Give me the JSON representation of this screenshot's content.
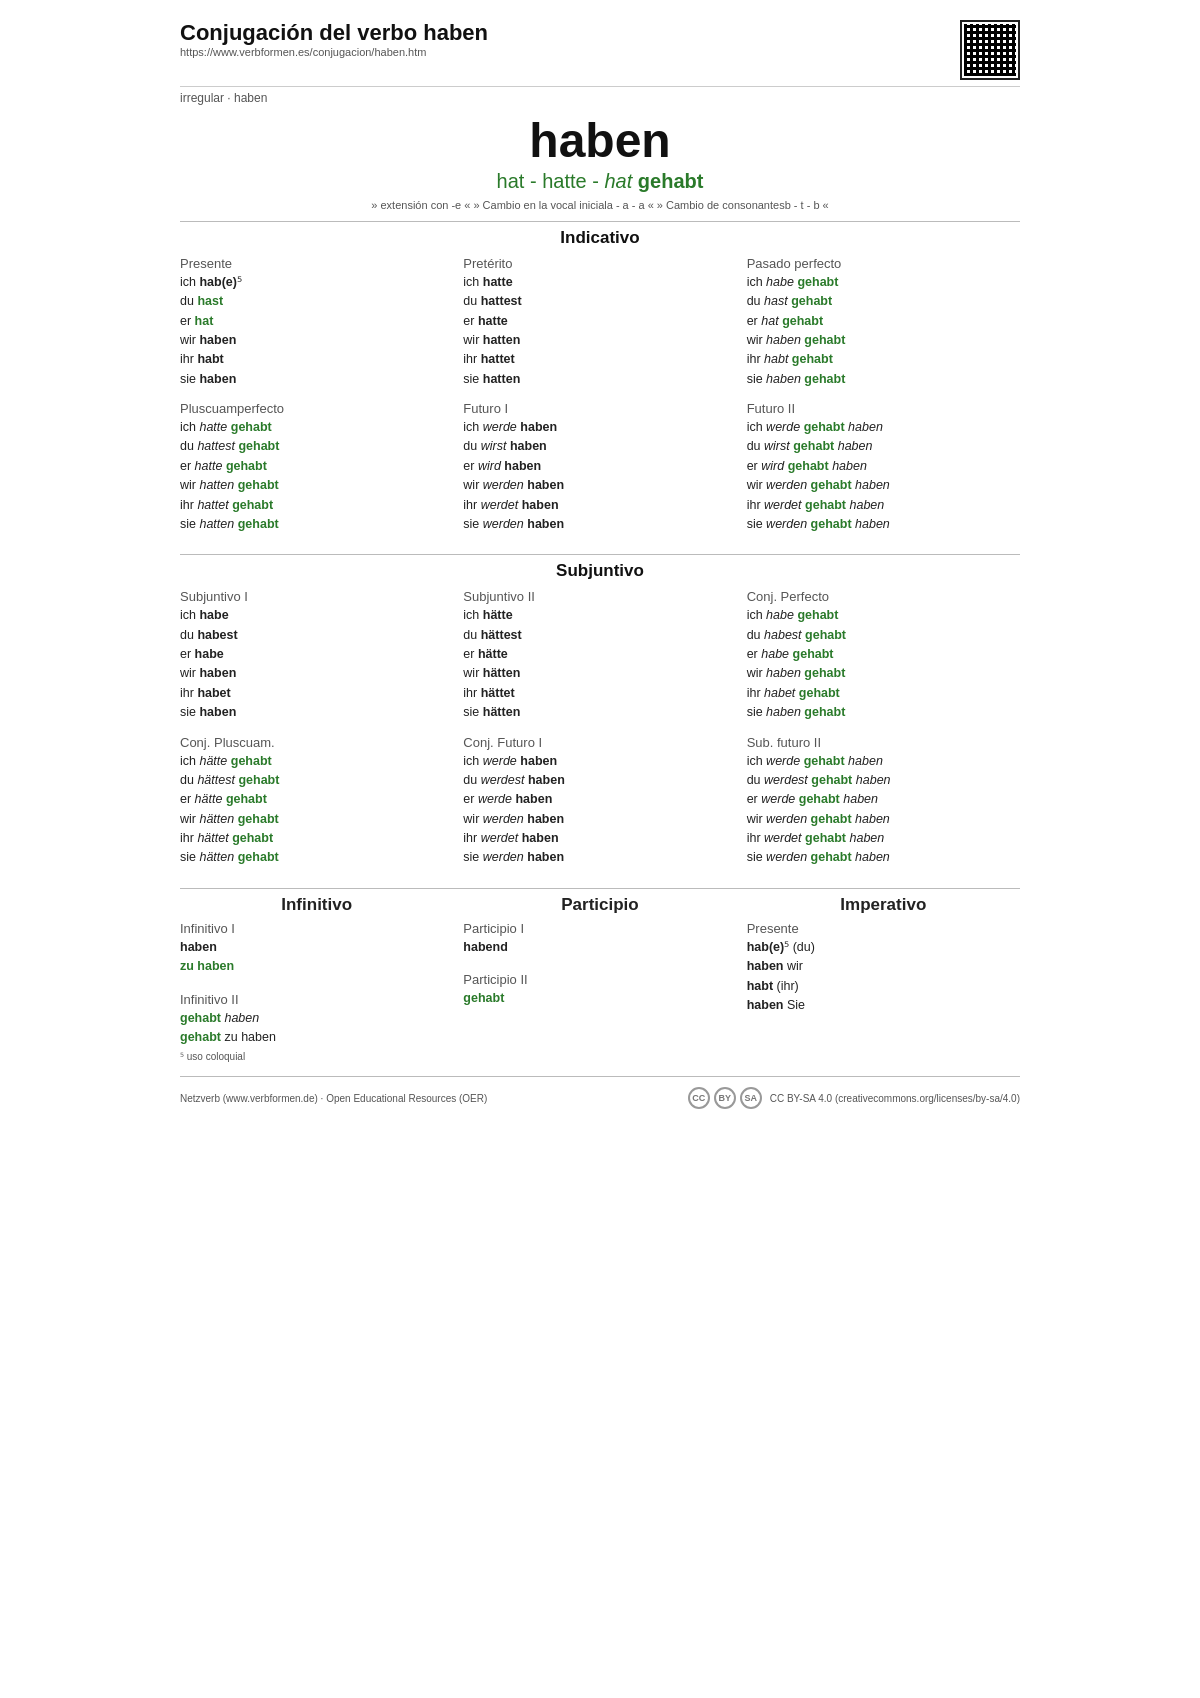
{
  "header": {
    "title": "Conjugación del verbo haben",
    "url": "https://www.verbformen.es/conjugacion/haben.htm",
    "tag": "irregular · haben"
  },
  "verb": {
    "main": "haben",
    "forms_line": "hat - hatte - hat gehabt",
    "extensions": "» extensión con -e « » Cambio en la vocal iniciala - a - a « » Cambio de consonantesb - t - b «"
  },
  "sections": {
    "indicativo": {
      "label": "Indicativo",
      "presente": {
        "title": "Presente",
        "rows": [
          "ich hab(e)⁵",
          "du hast",
          "er hat",
          "wir haben",
          "ihr habt",
          "sie haben"
        ]
      },
      "preterito": {
        "title": "Pretérito",
        "rows": [
          "ich hatte",
          "du hattest",
          "er hatte",
          "wir hatten",
          "ihr hattet",
          "sie hatten"
        ]
      },
      "pasado_perfecto": {
        "title": "Pasado perfecto",
        "rows": [
          "ich habe gehabt",
          "du hast gehabt",
          "er hat gehabt",
          "wir haben gehabt",
          "ihr habt gehabt",
          "sie haben gehabt"
        ]
      },
      "pluscuam": {
        "title": "Pluscuamperfecto",
        "rows": [
          "ich hatte gehabt",
          "du hattest gehabt",
          "er hatte gehabt",
          "wir hatten gehabt",
          "ihr hattet gehabt",
          "sie hatten gehabt"
        ]
      },
      "futuro1": {
        "title": "Futuro I",
        "rows": [
          "ich werde haben",
          "du wirst haben",
          "er wird haben",
          "wir werden haben",
          "ihr werdet haben",
          "sie werden haben"
        ]
      },
      "futuro2": {
        "title": "Futuro II",
        "rows": [
          "ich werde gehabt haben",
          "du wirst gehabt haben",
          "er wird gehabt haben",
          "wir werden gehabt haben",
          "ihr werdet gehabt haben",
          "sie werden gehabt haben"
        ]
      }
    },
    "subjuntivo": {
      "label": "Subjuntivo",
      "subj1": {
        "title": "Subjuntivo I",
        "rows": [
          "ich habe",
          "du habest",
          "er habe",
          "wir haben",
          "ihr habet",
          "sie haben"
        ]
      },
      "subj2": {
        "title": "Subjuntivo II",
        "rows": [
          "ich hätte",
          "du hättest",
          "er hätte",
          "wir hätten",
          "ihr hättet",
          "sie hätten"
        ]
      },
      "conj_perfecto": {
        "title": "Conj. Perfecto",
        "rows": [
          "ich habe gehabt",
          "du habest gehabt",
          "er habe gehabt",
          "wir haben gehabt",
          "ihr habet gehabt",
          "sie haben gehabt"
        ]
      },
      "conj_pluscuam": {
        "title": "Conj. Pluscuam.",
        "rows": [
          "ich hätte gehabt",
          "du hättest gehabt",
          "er hätte gehabt",
          "wir hätten gehabt",
          "ihr hättet gehabt",
          "sie hätten gehabt"
        ]
      },
      "conj_futuro1": {
        "title": "Conj. Futuro I",
        "rows": [
          "ich werde haben",
          "du werdest haben",
          "er werde haben",
          "wir werden haben",
          "ihr werdet haben",
          "sie werden haben"
        ]
      },
      "sub_futuro2": {
        "title": "Sub. futuro II",
        "rows": [
          "ich werde gehabt haben",
          "du werdest gehabt haben",
          "er werde gehabt haben",
          "wir werden gehabt haben",
          "ihr werdet gehabt haben",
          "sie werden gehabt haben"
        ]
      }
    },
    "infinitivo": {
      "label": "Infinitivo",
      "inf1_title": "Infinitivo I",
      "inf1_rows": [
        "haben",
        "zu haben"
      ],
      "inf2_title": "Infinitivo II",
      "inf2_rows": [
        "gehabt haben",
        "gehabt zu haben"
      ]
    },
    "participio": {
      "label": "Participio",
      "part1_title": "Participio I",
      "part1_rows": [
        "habend"
      ],
      "part2_title": "Participio II",
      "part2_rows": [
        "gehabt"
      ]
    },
    "imperativo": {
      "label": "Imperativo",
      "pres_title": "Presente",
      "pres_rows": [
        "hab(e)⁵ (du)",
        "haben wir",
        "habt (ihr)",
        "haben Sie"
      ]
    }
  },
  "footnote": "⁵ uso coloquial",
  "footer": {
    "left": "Netzverb (www.verbformen.de) · Open Educational Resources (OER)",
    "right": "CC BY-SA 4.0 (creativecommons.org/licenses/by-sa/4.0)"
  }
}
